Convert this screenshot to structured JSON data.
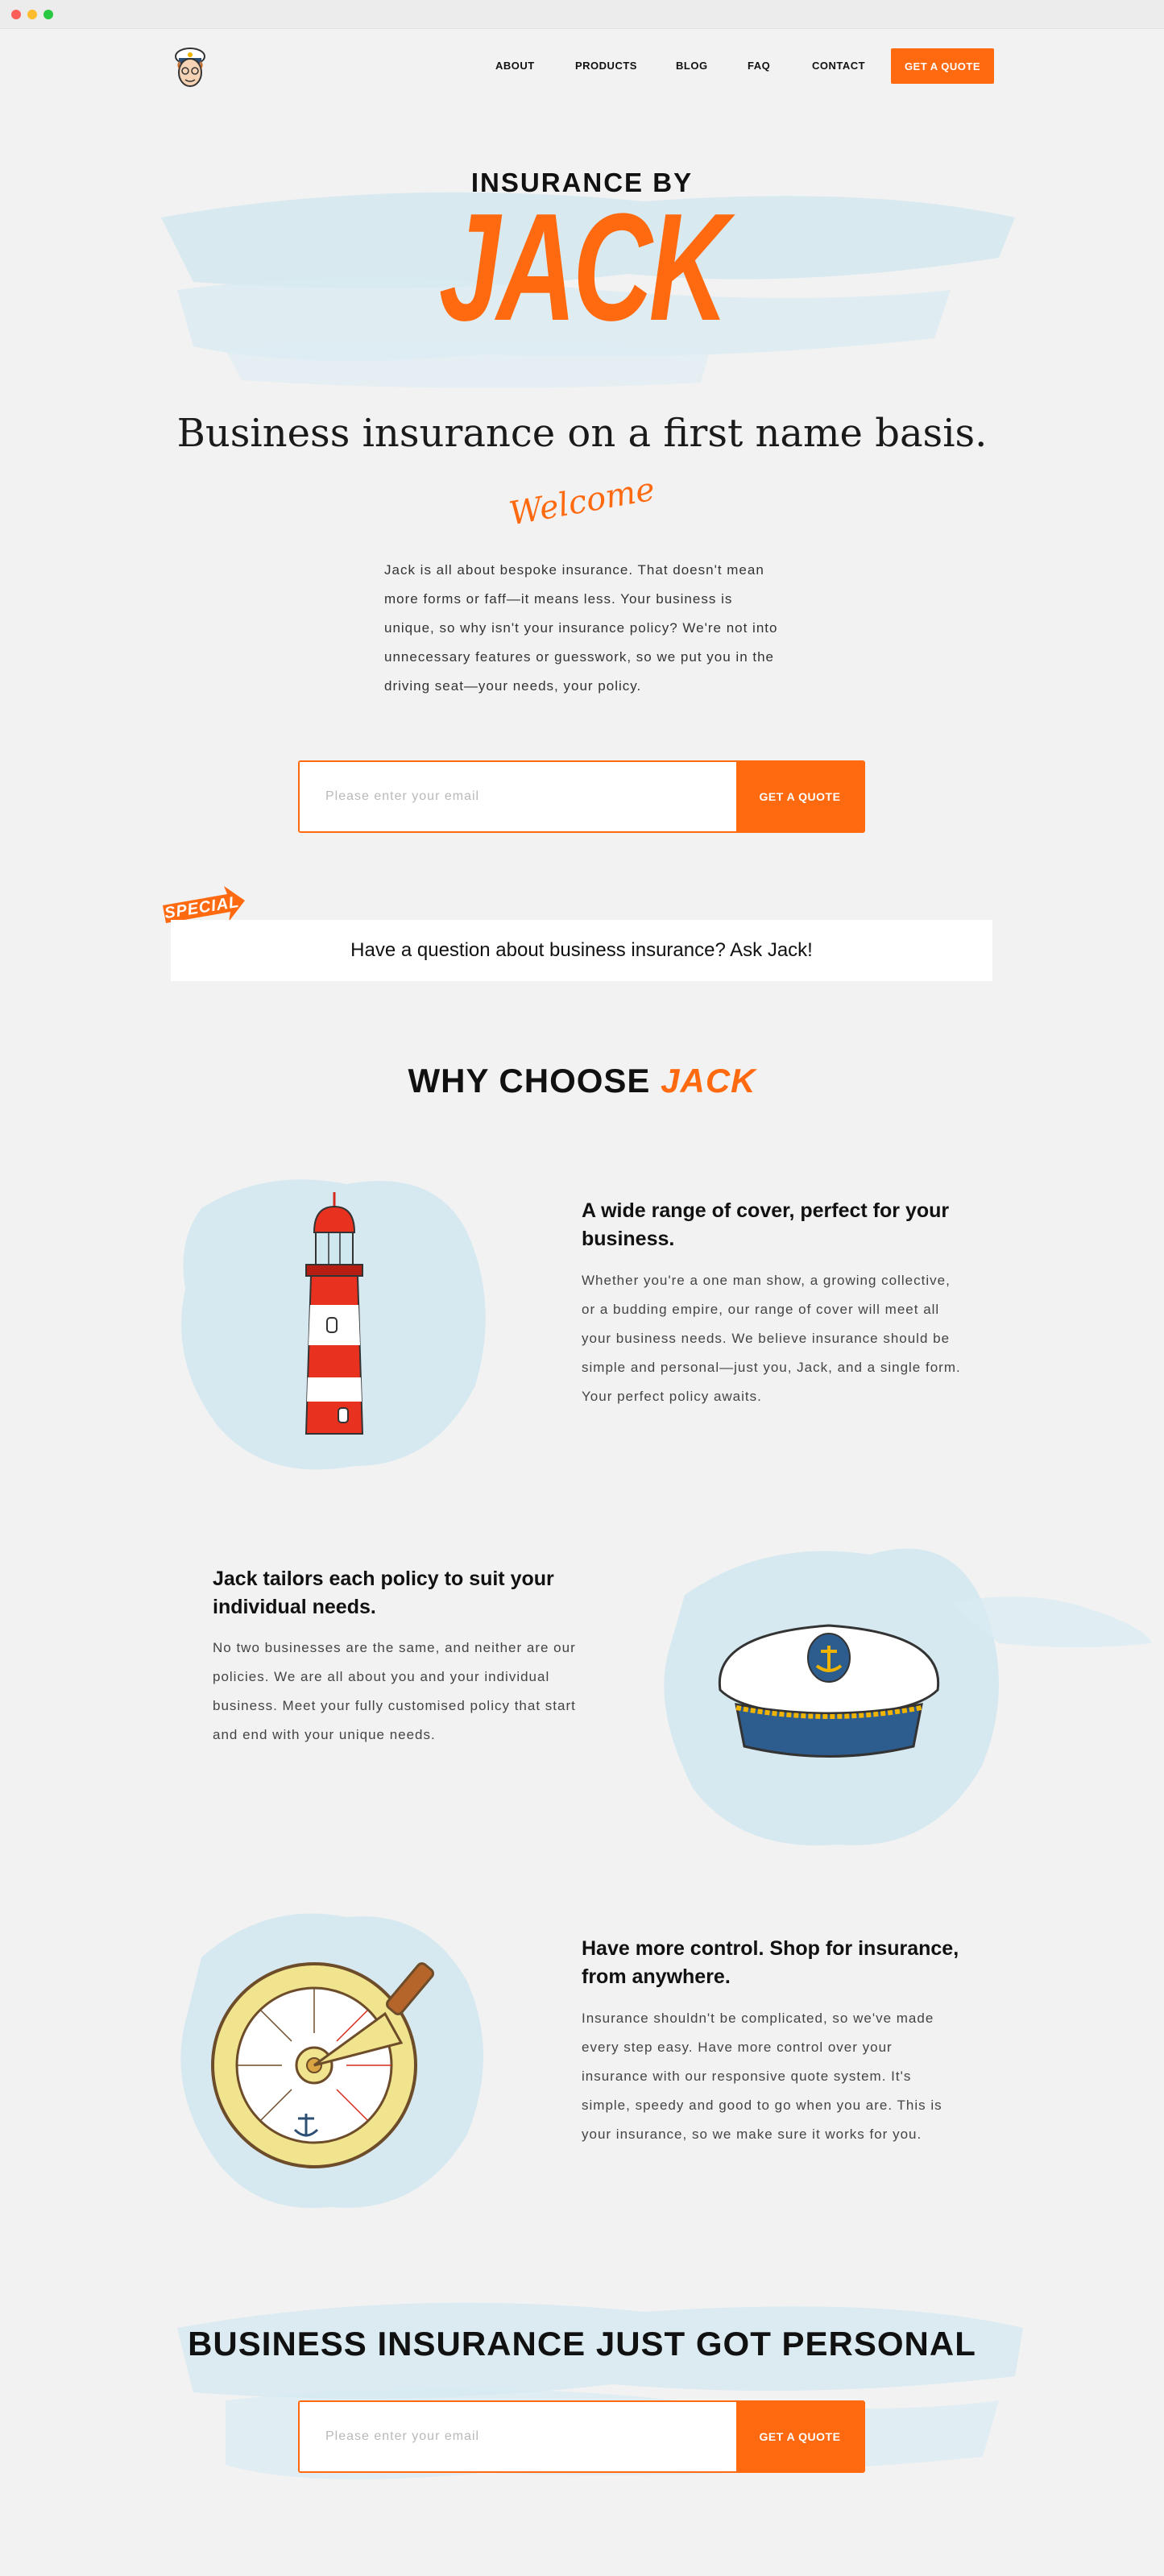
{
  "nav": {
    "about": "ABOUT",
    "products": "PRODUCTS",
    "blog": "BLOG",
    "faq": "FAQ",
    "contact": "CONTACT",
    "cta": "GET A QUOTE"
  },
  "hero": {
    "eyebrow": "INSURANCE BY",
    "brand": "JACK",
    "headline": "Business insurance on a first name basis.",
    "welcome": "Welcome",
    "intro": "Jack is all about bespoke insurance. That doesn't mean more forms or faff—it means less. Your business is unique, so why isn't your insurance policy? We're not into unnecessary features or guesswork, so we put you in the driving seat—your needs, your policy.",
    "email_placeholder": "Please enter your email",
    "cta": "GET A QUOTE"
  },
  "special": {
    "badge": "SPECIAL",
    "text": "Have a question about business insurance? Ask Jack!"
  },
  "why": {
    "title": "WHY CHOOSE",
    "accent": "JACK"
  },
  "features": [
    {
      "title": "A wide range of cover, perfect for your business.",
      "body": "Whether you're a one man show, a growing collective, or a budding empire, our range of cover will meet all your business needs. We believe insurance should be simple and personal—just you, Jack, and a single form. Your perfect policy awaits.",
      "icon": "lighthouse-icon"
    },
    {
      "title": "Jack tailors each policy to suit your individual needs.",
      "body": "No two businesses are the same, and neither are our policies. We are all about you and your individual business. Meet your fully customised policy that start and end with your unique needs.",
      "icon": "captain-hat-icon"
    },
    {
      "title": "Have more control. Shop for insurance, from anywhere.",
      "body": "Insurance shouldn't be complicated, so we've made every step easy. Have more control over your insurance with our responsive quote system. It's simple, speedy and good to go when you are. This is your insurance, so we make sure it works for you.",
      "icon": "compass-icon"
    }
  ],
  "closing": {
    "title": "BUSINESS INSURANCE JUST GOT PERSONAL",
    "email_placeholder": "Please enter your email",
    "cta": "GET A QUOTE"
  },
  "colors": {
    "accent": "#ff6a10",
    "background": "#f2f2f2",
    "wash": "#cfe6ee"
  }
}
